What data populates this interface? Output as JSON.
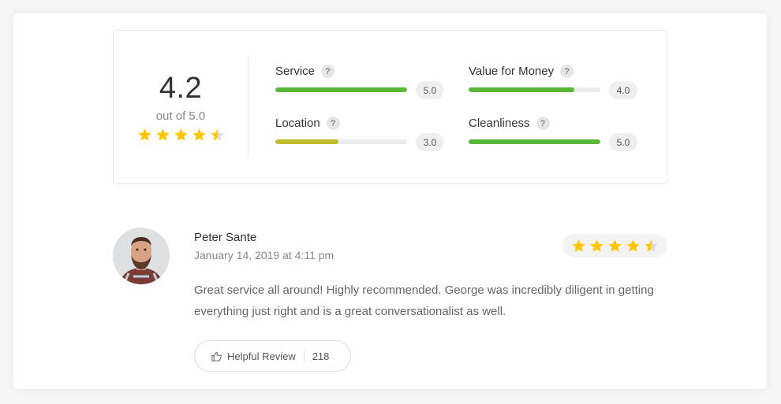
{
  "summary": {
    "score": "4.2",
    "out_of": "out of 5.0",
    "stars": [
      1,
      1,
      1,
      1,
      0.5
    ]
  },
  "categories": [
    {
      "name": "Service",
      "value": "5.0",
      "fraction": 1.0,
      "color": "#5ab738"
    },
    {
      "name": "Value for Money",
      "value": "4.0",
      "fraction": 0.8,
      "color": "#5ab738"
    },
    {
      "name": "Location",
      "value": "3.0",
      "fraction": 0.48,
      "color": "#c0be2b"
    },
    {
      "name": "Cleanliness",
      "value": "5.0",
      "fraction": 1.0,
      "color": "#5ab738"
    }
  ],
  "help_glyph": "?",
  "review": {
    "author": "Peter Sante",
    "date": "January 14, 2019 at 4:11 pm",
    "stars": [
      1,
      1,
      1,
      1,
      0.5
    ],
    "text": "Great service all around! Highly recommended. George was incredibly diligent in getting everything just right and is a great conversationalist as well.",
    "helpful_label": "Helpful Review",
    "helpful_count": "218"
  },
  "colors": {
    "star": "#ffc600",
    "star_empty": "#dcdcdc"
  }
}
